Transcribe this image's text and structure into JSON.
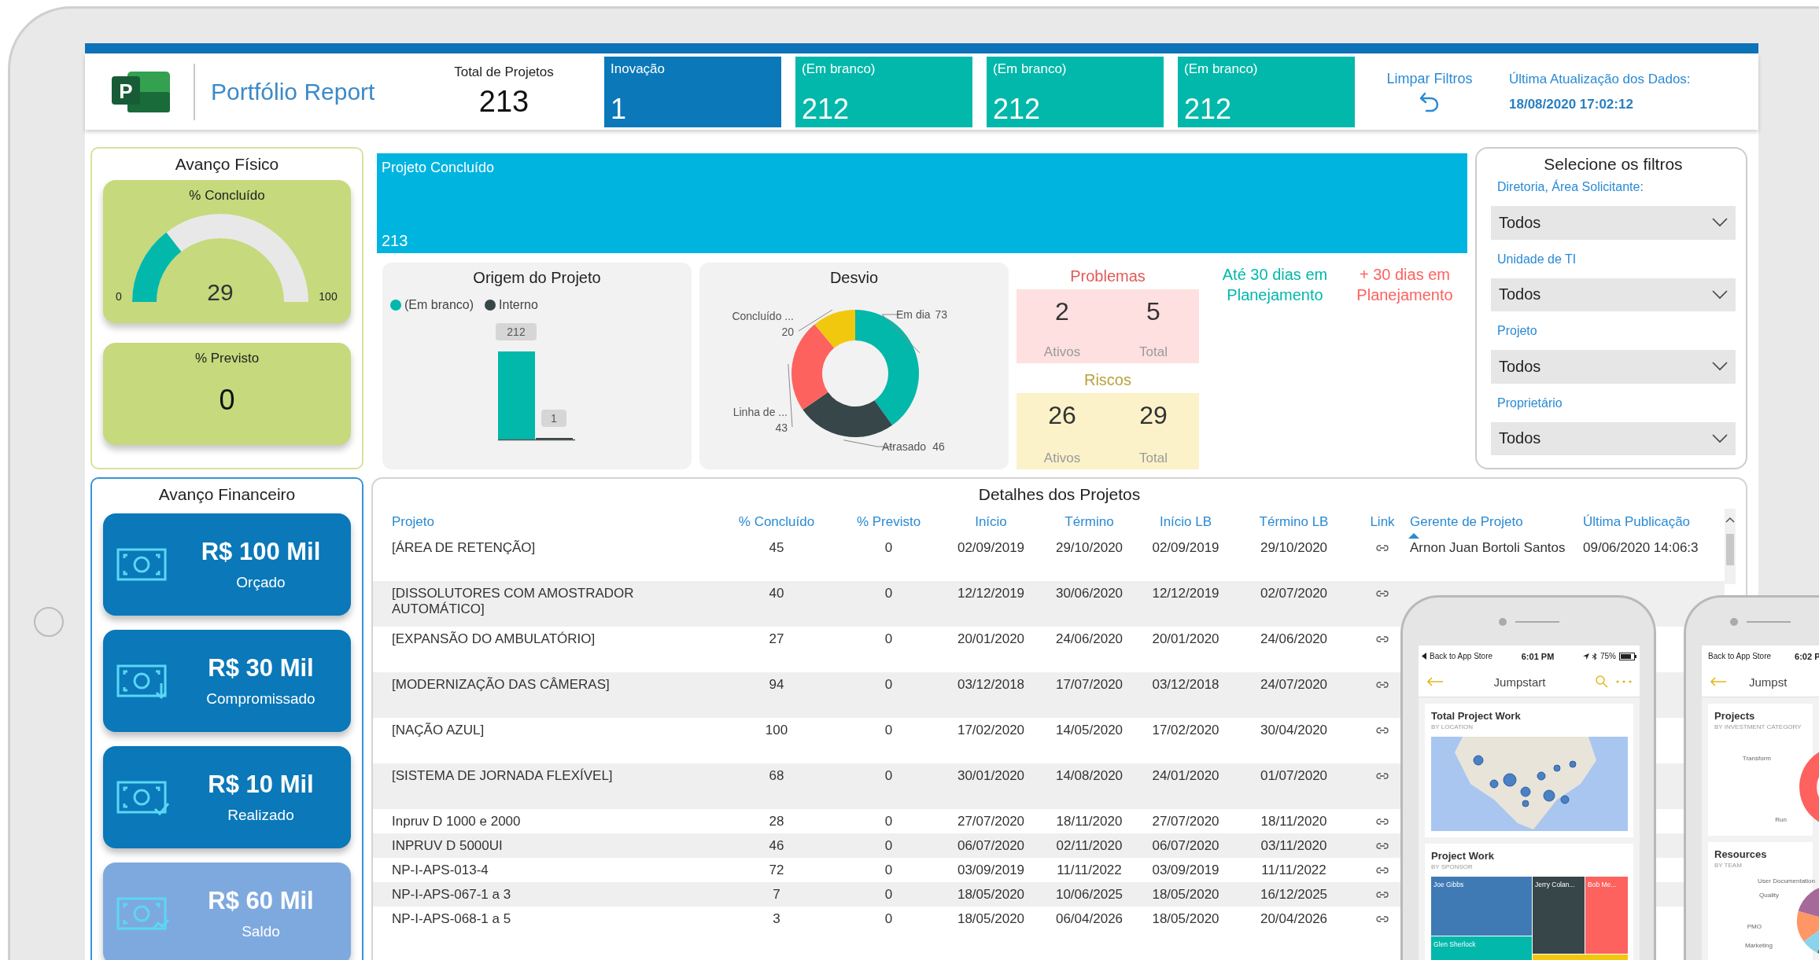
{
  "header": {
    "logo_letter": "P",
    "app_title": "Portfólio Report",
    "total": {
      "label": "Total de Projetos",
      "value": "213"
    },
    "cards": [
      {
        "label": "Inovação",
        "value": "1",
        "color": "#0a78b9"
      },
      {
        "label": "(Em branco)",
        "value": "212",
        "color": "#01b8aa"
      },
      {
        "label": "(Em branco)",
        "value": "212",
        "color": "#01b8aa"
      },
      {
        "label": "(Em branco)",
        "value": "212",
        "color": "#01b8aa"
      }
    ],
    "clear_filters": "Limpar Filtros",
    "last_update": {
      "label": "Última Atualização dos Dados:",
      "value": "18/08/2020 17:02:12"
    }
  },
  "avanco_fisico": {
    "title": "Avanço Físico",
    "concluido": {
      "label": "% Concluído",
      "value": "29",
      "level": 0.29,
      "min": "0",
      "max": "100"
    },
    "previsto": {
      "label": "% Previsto",
      "value": "0"
    }
  },
  "avanco_financeiro": {
    "title": "Avanço Financeiro",
    "cards": [
      {
        "kind": "budget",
        "value": "R$ 100 Mil",
        "label": "Orçado",
        "color": "#0a78b9"
      },
      {
        "kind": "committed",
        "value": "R$ 30 Mil",
        "label": "Compromissado",
        "color": "#0a78b9"
      },
      {
        "kind": "realized",
        "value": "R$ 10 Mil",
        "label": "Realizado",
        "color": "#0a78b9"
      },
      {
        "kind": "balance",
        "value": "R$ 60 Mil",
        "label": "Saldo",
        "color": "#7ea9df"
      }
    ]
  },
  "projeto_concluido": {
    "label": "Projeto Concluído",
    "value": "213"
  },
  "origem": {
    "title": "Origem do Projeto",
    "chart_data": {
      "type": "bar",
      "series": [
        {
          "name": "(Em branco)",
          "color": "#01b8aa",
          "values": [
            212
          ]
        },
        {
          "name": "Interno",
          "color": "#374649",
          "values": [
            1
          ]
        }
      ],
      "data_labels": true
    }
  },
  "desvio": {
    "title": "Desvio",
    "chart_data": {
      "type": "donut",
      "categories": [
        "Em dia",
        "Atrasado",
        "Linha de ...",
        "Concluído ..."
      ],
      "values": [
        73,
        46,
        43,
        20
      ],
      "data_labels": true
    }
  },
  "problemas": {
    "title": "Problemas",
    "items": [
      {
        "value": "2",
        "label": "Ativos"
      },
      {
        "value": "5",
        "label": "Total"
      }
    ]
  },
  "riscos": {
    "title": "Riscos",
    "items": [
      {
        "value": "26",
        "label": "Ativos"
      },
      {
        "value": "29",
        "label": "Total"
      }
    ]
  },
  "planejamento": [
    {
      "text": "Até 30 dias em Planejamento",
      "color": "#01b8aa"
    },
    {
      "text": "+ 30 dias em Planejamento",
      "color": "#fd625e"
    }
  ],
  "filters": {
    "title": "Selecione os filtros",
    "items": [
      {
        "label": "Diretoria, Área Solicitante:",
        "value": "Todos"
      },
      {
        "label": "Unidade de TI",
        "value": "Todos"
      },
      {
        "label": "Projeto",
        "value": "Todos"
      },
      {
        "label": "Proprietário",
        "value": "Todos"
      }
    ]
  },
  "details": {
    "title": "Detalhes dos Projetos",
    "columns": [
      {
        "label": "Projeto",
        "sorted": false
      },
      {
        "label": "% Concluído",
        "sorted": false
      },
      {
        "label": "% Previsto",
        "sorted": false
      },
      {
        "label": "Início",
        "sorted": false
      },
      {
        "label": "Término",
        "sorted": false
      },
      {
        "label": "Início LB",
        "sorted": false
      },
      {
        "label": "Término LB",
        "sorted": false
      },
      {
        "label": "Link",
        "sorted": false
      },
      {
        "label": "Gerente de Projeto",
        "sorted": true
      },
      {
        "label": "Última Publicação",
        "sorted": false
      }
    ],
    "rows": [
      {
        "cells": [
          "[ÁREA DE RETENÇÃO]",
          "45",
          "0",
          "02/09/2019",
          "29/10/2020",
          "02/09/2019",
          "29/10/2020"
        ],
        "gerente": "Arnon Juan Bortoli Santos",
        "ultima_publicacao": "09/06/2020 14:06:3"
      },
      {
        "cells": [
          "[DISSOLUTORES COM AMOSTRADOR AUTOMÁTICO]",
          "40",
          "0",
          "12/12/2019",
          "30/06/2020",
          "12/12/2019",
          "02/07/2020"
        ]
      },
      {
        "cells": [
          "[EXPANSÃO DO AMBULATÓRIO]",
          "27",
          "0",
          "20/01/2020",
          "24/06/2020",
          "20/01/2020",
          "24/06/2020"
        ]
      },
      {
        "cells": [
          "[MODERNIZAÇÃO DAS CÂMERAS]",
          "94",
          "0",
          "03/12/2018",
          "17/07/2020",
          "03/12/2018",
          "24/07/2020"
        ]
      },
      {
        "cells": [
          "[NAÇÃO AZUL]",
          "100",
          "0",
          "17/02/2020",
          "14/05/2020",
          "17/02/2020",
          "30/04/2020"
        ]
      },
      {
        "cells": [
          "[SISTEMA DE JORNADA FLEXÍVEL]",
          "68",
          "0",
          "30/01/2020",
          "14/08/2020",
          "24/01/2020",
          "01/07/2020"
        ]
      },
      {
        "cells": [
          "Inpruv D 1000 e 2000",
          "28",
          "0",
          "27/07/2020",
          "18/11/2020",
          "27/07/2020",
          "18/11/2020"
        ]
      },
      {
        "cells": [
          "INPRUV D 5000UI",
          "46",
          "0",
          "06/07/2020",
          "02/11/2020",
          "06/07/2020",
          "03/11/2020"
        ]
      },
      {
        "cells": [
          "NP-I-APS-013-4",
          "72",
          "0",
          "03/09/2019",
          "11/11/2022",
          "03/09/2019",
          "11/11/2022"
        ]
      },
      {
        "cells": [
          "NP-I-APS-067-1 a 3",
          "7",
          "0",
          "18/05/2020",
          "10/06/2025",
          "18/05/2020",
          "16/12/2025"
        ]
      },
      {
        "cells": [
          "NP-I-APS-068-1 a 5",
          "3",
          "0",
          "18/05/2020",
          "06/04/2026",
          "18/05/2020",
          "20/04/2026"
        ]
      }
    ]
  },
  "phones": [
    {
      "back": "Back to App Store",
      "time": "6:01 PM",
      "battery": "75%",
      "title": "Jumpstart",
      "cards": [
        {
          "kind": "map",
          "title": "Total Project Work",
          "subtitle": "BY LOCATION"
        },
        {
          "kind": "treemap",
          "title": "Project Work",
          "subtitle": "BY SPONSOR",
          "labels": [
            "Joe Gibbs",
            "Jerry Colan...",
            "Bob Me...",
            "Glen Sherlock"
          ]
        }
      ]
    },
    {
      "back": "Back to App Store",
      "time": "6:02 P",
      "title": "Jumpst",
      "cards": [
        {
          "kind": "donut",
          "title": "Projects",
          "subtitle": "BY INVESTMENT CATEGORY",
          "labels": [
            "Transform",
            "Run"
          ]
        },
        {
          "kind": "pie",
          "title": "Resources",
          "subtitle": "BY TEAM",
          "labels": [
            "User Documentation",
            "Quality",
            "PMO",
            "Marketing"
          ]
        }
      ]
    }
  ]
}
